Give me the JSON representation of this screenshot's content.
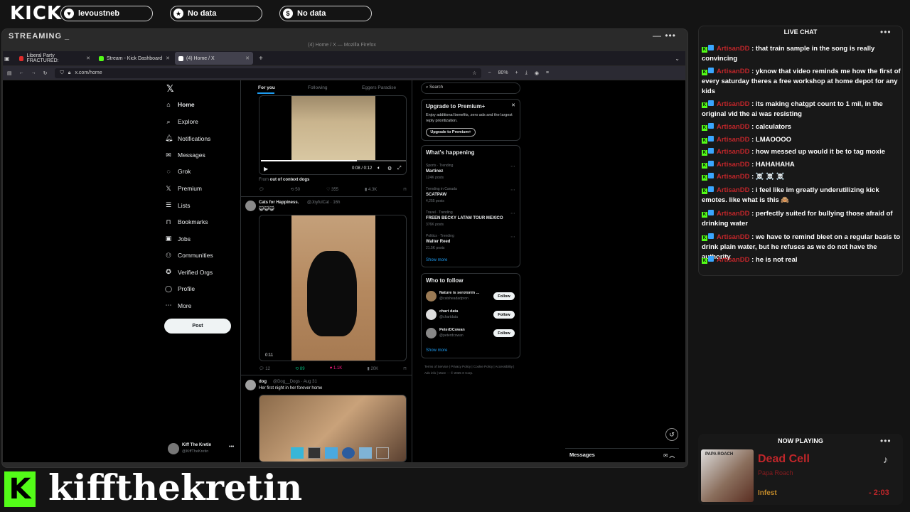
{
  "overlay": {
    "logo": "KICK",
    "pills": [
      {
        "icon": "heart-icon",
        "label": "levoustneb"
      },
      {
        "icon": "star-icon",
        "label": "No data"
      },
      {
        "icon": "dollar-icon",
        "label": "No data"
      }
    ],
    "stream_label": "STREAMING _",
    "streamer_name": "kiffthekretin"
  },
  "browser": {
    "window_title": "(4) Home / X — Mozilla Firefox",
    "tabs": [
      {
        "label": "Liberal Party FRACTURED:",
        "active": false,
        "color": "#e02b2b"
      },
      {
        "label": "Stream - Kick Dashboard",
        "active": false,
        "color": "#53fc18"
      },
      {
        "label": "(4) Home / X",
        "active": true,
        "color": "#ffffff"
      }
    ],
    "url": "x.com/home",
    "zoom": "80%"
  },
  "x": {
    "nav": [
      {
        "icon": "home-icon",
        "label": "Home"
      },
      {
        "icon": "search-icon",
        "label": "Explore"
      },
      {
        "icon": "bell-icon",
        "label": "Notifications"
      },
      {
        "icon": "mail-icon",
        "label": "Messages"
      },
      {
        "icon": "grok-icon",
        "label": "Grok"
      },
      {
        "icon": "x-icon",
        "label": "Premium"
      },
      {
        "icon": "list-icon",
        "label": "Lists"
      },
      {
        "icon": "bookmark-icon",
        "label": "Bookmarks"
      },
      {
        "icon": "briefcase-icon",
        "label": "Jobs"
      },
      {
        "icon": "people-icon",
        "label": "Communities"
      },
      {
        "icon": "verified-icon",
        "label": "Verified Orgs"
      },
      {
        "icon": "person-icon",
        "label": "Profile"
      },
      {
        "icon": "more-icon",
        "label": "More"
      }
    ],
    "post_button": "Post",
    "account": {
      "name": "Kiff The Kretin",
      "handle": "@KiffTheKretin"
    },
    "feed_tabs": [
      "For you",
      "Following",
      "Eggers Paradise"
    ],
    "video1": {
      "time": "0:08 / 0:12",
      "from_prefix": "From",
      "from": "out of context dogs",
      "stats": [
        "",
        "50",
        "355",
        "4.3K"
      ]
    },
    "post2": {
      "author": "Cats for Happiness.",
      "handle": "@JoyfulCat · 16h",
      "text": "😺😺😺",
      "video_time": "0:11",
      "stats": [
        "12",
        "89",
        "1.1K",
        "20K"
      ]
    },
    "post3": {
      "author": "dog",
      "handle": "@Dog__Dogs · Aug 31",
      "text": "Her first night in her forever home"
    },
    "search_placeholder": "Search",
    "premium": {
      "title": "Upgrade to Premium+",
      "desc": "Enjoy additional benefits, zero ads and the largest reply prioritization.",
      "button": "Upgrade to Premium+"
    },
    "happening": {
      "title": "What's happening",
      "trends": [
        {
          "context": "Sports · Trending",
          "name": "Martinez",
          "posts": "124K posts"
        },
        {
          "context": "Trending in Canada",
          "name": "SCATPAW",
          "posts": "4,255 posts"
        },
        {
          "context": "Travel · Trending",
          "name": "FREEN BECKY LATAM TOUR MEXICO",
          "posts": "376K posts"
        },
        {
          "context": "Politics · Trending",
          "name": "Walter Reed",
          "posts": "21.5K posts"
        }
      ],
      "show_more": "Show more"
    },
    "who_to_follow": {
      "title": "Who to follow",
      "accounts": [
        {
          "name": "Nature is serotonin ...",
          "handle": "@catsheadadpron"
        },
        {
          "name": "chart data",
          "handle": "@chartdata"
        },
        {
          "name": "PeterDCowan",
          "handle": "@peterdcowan"
        }
      ],
      "follow_label": "Follow",
      "show_more": "Show more"
    },
    "footer": "Terms of Service | Privacy Policy | Cookie Policy | Accessibility | Ads info | More ··· © 2025 X Corp.",
    "messages_label": "Messages"
  },
  "chat": {
    "title": "LIVE CHAT",
    "messages": [
      {
        "user": "ArtisanDD",
        "text": "that train sample in the song is really convincing"
      },
      {
        "user": "ArtisanDD",
        "text": "yknow that video reminds me how the first of every saturday theres a free workshop at home depot for any kids"
      },
      {
        "user": "ArtisanDD",
        "text": "its making chatgpt count to 1 mil, in the original vid the ai was resisting"
      },
      {
        "user": "ArtisanDD",
        "text": "calculators"
      },
      {
        "user": "ArtisanDD",
        "text": "LMAOOOO"
      },
      {
        "user": "ArtisanDD",
        "text": "how messed up would it be to tag moxie"
      },
      {
        "user": "ArtisanDD",
        "text": "HAHAHAHA"
      },
      {
        "user": "ArtisanDD",
        "text": "☠️ ☠️ ☠️"
      },
      {
        "user": "ArtisanDD",
        "text": "i feel like im greatly underutilizing kick emotes. like what is this 🙈"
      },
      {
        "user": "ArtisanDD",
        "text": "perfectly suited for bullying those afraid of drinking water"
      },
      {
        "user": "ArtisanDD",
        "text": "we have to remind bleet on a regular basis to drink plain water, but he refuses as we do not have the authority"
      },
      {
        "user": "ArtisanDD",
        "text": "he is not real"
      }
    ]
  },
  "now_playing": {
    "title": "NOW PLAYING",
    "song": "Dead Cell",
    "artist": "Papa Roach",
    "album": "Infest",
    "album_art_text": "PAPA ROACH",
    "remaining": "- 2:03"
  },
  "colors": {
    "kick_green": "#53fc18",
    "chat_user": "#c0262a",
    "x_blue": "#1d9bf0"
  }
}
